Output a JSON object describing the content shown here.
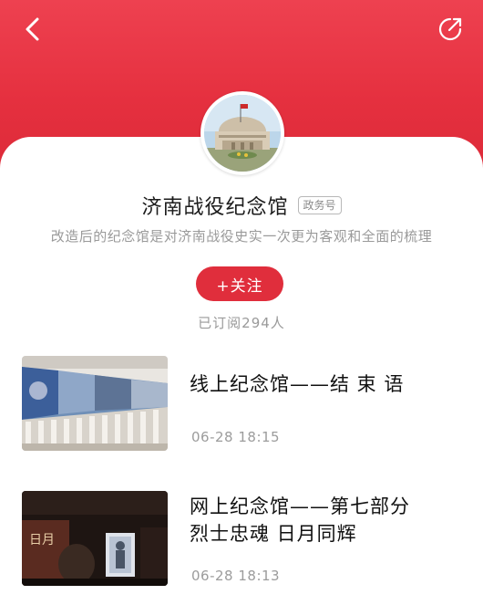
{
  "header": {
    "back_icon": "chevron-left-icon",
    "share_icon": "share-arrow-icon",
    "color": "#e5303f"
  },
  "profile": {
    "name": "济南战役纪念馆",
    "badge": "政务号",
    "description": "改造后的纪念馆是对济南战役史实一次更为客观和全面的梳理",
    "follow_label": "+关注",
    "subscribers": "已订阅294人"
  },
  "articles": [
    {
      "title_line1": "线上纪念馆——结 束 语",
      "title_line2": "",
      "time": "06-28 18:15"
    },
    {
      "title_line1": "网上纪念馆——第七部分",
      "title_line2": "烈士忠魂 日月同辉",
      "time": "06-28 18:13",
      "thumb_text": "日月"
    }
  ]
}
